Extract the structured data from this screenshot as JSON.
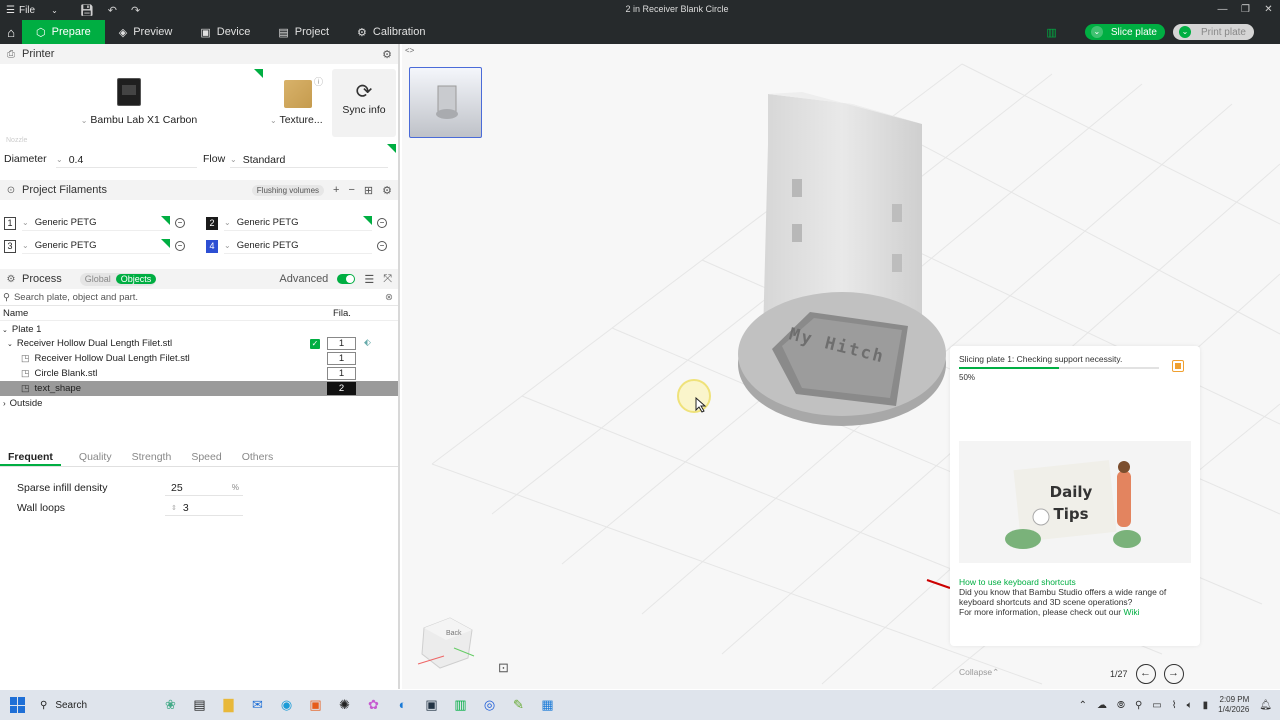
{
  "titlebar": {
    "file": "File",
    "title": "2 in Receiver Blank Circle"
  },
  "nav": {
    "tabs": [
      {
        "label": "Prepare"
      },
      {
        "label": "Preview"
      },
      {
        "label": "Device"
      },
      {
        "label": "Project"
      },
      {
        "label": "Calibration"
      }
    ],
    "slice_plate": "Slice plate",
    "print_plate": "Print plate"
  },
  "printer": {
    "header": "Printer",
    "name": "Bambu Lab X1 Carbon",
    "plate_label": "Texture...",
    "sync_label": "Sync info",
    "nozzle_label": "Nozzle",
    "diameter_label": "Diameter",
    "diameter_value": "0.4",
    "flow_label": "Flow",
    "flow_value": "Standard"
  },
  "filaments": {
    "header": "Project Filaments",
    "flushing": "Flushing volumes",
    "items": [
      {
        "num": "1",
        "name": "Generic PETG",
        "color": "#ffffff"
      },
      {
        "num": "2",
        "name": "Generic PETG",
        "color": "#1a1a1a"
      },
      {
        "num": "3",
        "name": "Generic PETG",
        "color": "#ffffff"
      },
      {
        "num": "4",
        "name": "Generic PETG",
        "color": "#2d4fd3"
      }
    ]
  },
  "process": {
    "header": "Process",
    "global": "Global",
    "objects": "Objects",
    "advanced": "Advanced",
    "search_placeholder": "Search plate, object and part.",
    "col_name": "Name",
    "col_fila": "Fila.",
    "tree": [
      {
        "label": "Plate 1",
        "fila": ""
      },
      {
        "label": "Receiver Hollow Dual Length Filet.stl",
        "fila": "1"
      },
      {
        "label": "Receiver Hollow Dual Length Filet.stl",
        "fila": "1"
      },
      {
        "label": "Circle Blank.stl",
        "fila": "1"
      },
      {
        "label": "text_shape",
        "fila": "2"
      },
      {
        "label": "Outside",
        "fila": ""
      }
    ],
    "tabs": [
      "Frequent",
      "Quality",
      "Strength",
      "Speed",
      "Others"
    ],
    "params": [
      {
        "label": "Sparse infill density",
        "value": "25",
        "unit": "%"
      },
      {
        "label": "Wall loops",
        "value": "3",
        "unit": ""
      }
    ]
  },
  "viewport": {
    "emboss_text": "My Hitch",
    "cube_label": "Back"
  },
  "slicing": {
    "status": "Slicing plate 1: Checking support necessity.",
    "progress": 50,
    "percent_text": "50%",
    "tips_title": "Daily Tips",
    "tip_heading": "How to use keyboard shortcuts",
    "tip_body": "Did you know that Bambu Studio offers a wide range of keyboard shortcuts and 3D scene operations?",
    "tip_more": "For more information, please check out our",
    "tip_link": "Wiki",
    "collapse": "Collapse",
    "pager": "1/27"
  },
  "taskbar": {
    "search": "Search",
    "time": "2:09 PM",
    "date": "1/4/2026"
  },
  "colors": {
    "accent": "#00ae42",
    "dark": "#262a2c"
  }
}
